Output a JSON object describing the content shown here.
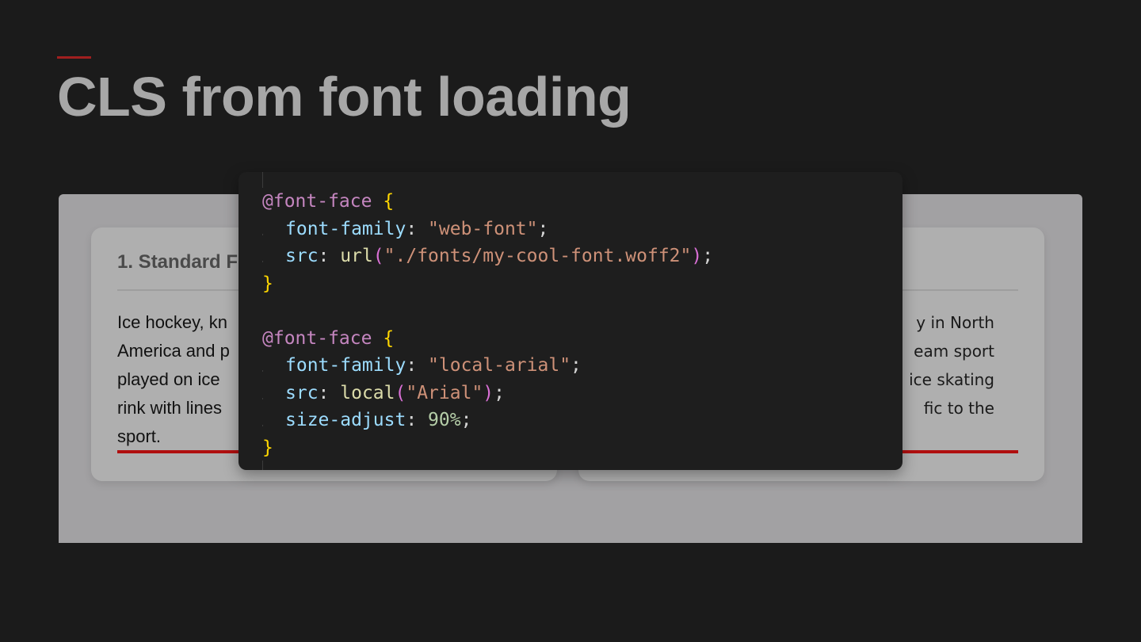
{
  "slide": {
    "title": "CLS from font loading"
  },
  "demo": {
    "left_card": {
      "heading": "1. Standard F",
      "text": "Ice hockey, kn\nAmerica and p\nplayed on ice\nrink with lines\nsport."
    },
    "right_card": {
      "text": "y in North\neam sport\nice skating\nfic to the"
    }
  },
  "code": {
    "lines": [
      [
        {
          "text": "@font-face",
          "kind": "at"
        },
        {
          "text": " ",
          "kind": "punc"
        },
        {
          "text": "{",
          "kind": "brace"
        }
      ],
      [
        {
          "text": "font-family",
          "kind": "prop"
        },
        {
          "text": ": ",
          "kind": "punc"
        },
        {
          "text": "\"web-font\"",
          "kind": "str"
        },
        {
          "text": ";",
          "kind": "punc"
        }
      ],
      [
        {
          "text": "src",
          "kind": "prop"
        },
        {
          "text": ": ",
          "kind": "punc"
        },
        {
          "text": "url",
          "kind": "fn"
        },
        {
          "text": "(",
          "kind": "paren"
        },
        {
          "text": "\"./fonts/my-cool-font.woff2\"",
          "kind": "str"
        },
        {
          "text": ")",
          "kind": "paren"
        },
        {
          "text": ";",
          "kind": "punc"
        }
      ],
      [
        {
          "text": "}",
          "kind": "brace"
        }
      ],
      [],
      [
        {
          "text": "@font-face",
          "kind": "at"
        },
        {
          "text": " ",
          "kind": "punc"
        },
        {
          "text": "{",
          "kind": "brace"
        }
      ],
      [
        {
          "text": "font-family",
          "kind": "prop"
        },
        {
          "text": ": ",
          "kind": "punc"
        },
        {
          "text": "\"local-arial\"",
          "kind": "str"
        },
        {
          "text": ";",
          "kind": "punc"
        }
      ],
      [
        {
          "text": "src",
          "kind": "prop"
        },
        {
          "text": ": ",
          "kind": "punc"
        },
        {
          "text": "local",
          "kind": "fn"
        },
        {
          "text": "(",
          "kind": "paren"
        },
        {
          "text": "\"Arial\"",
          "kind": "str"
        },
        {
          "text": ")",
          "kind": "paren"
        },
        {
          "text": ";",
          "kind": "punc"
        }
      ],
      [
        {
          "text": "size-adjust",
          "kind": "prop"
        },
        {
          "text": ": ",
          "kind": "punc"
        },
        {
          "text": "90%",
          "kind": "num"
        },
        {
          "text": ";",
          "kind": "punc"
        }
      ],
      [
        {
          "text": "}",
          "kind": "brace"
        }
      ]
    ],
    "indented_lines": [
      1,
      2,
      6,
      7,
      8
    ]
  },
  "colors": {
    "background": "#1b1b1b",
    "title": "#a7a7a7",
    "accent": "#a01f1f",
    "demo_panel": "#a2a1a3",
    "card": "#afafaf",
    "underline": "#b00f0f",
    "code_background": "#1e1e1e",
    "syntax_at_rule": "#c586c0",
    "syntax_brace": "#ffd700",
    "syntax_paren": "#da70d6",
    "syntax_property": "#9cdcfe",
    "syntax_string": "#ce9178",
    "syntax_function": "#dcdcaa",
    "syntax_number": "#b5cea8"
  }
}
